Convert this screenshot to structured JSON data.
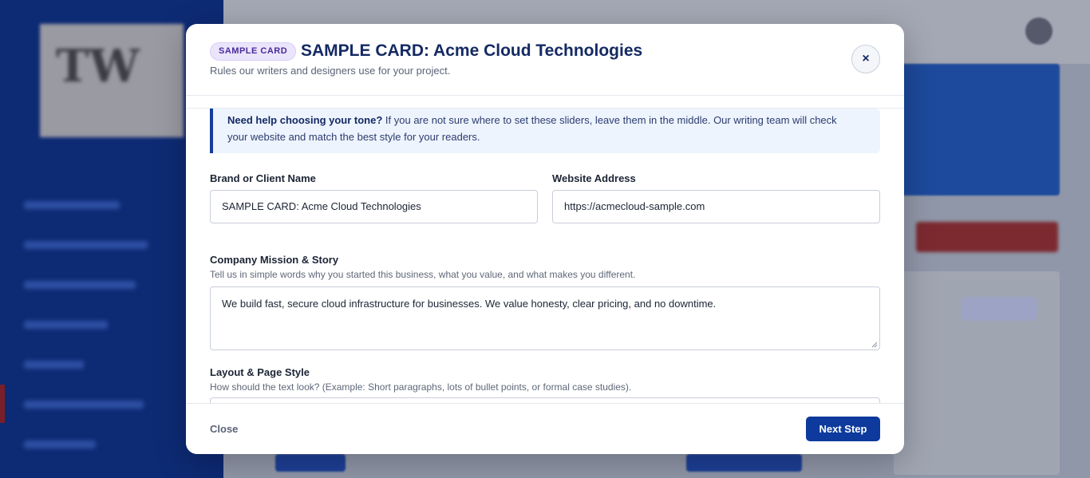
{
  "modal": {
    "badge": "SAMPLE CARD",
    "title": "SAMPLE CARD: Acme Cloud Technologies",
    "subtitle": "Rules our writers and designers use for your project.",
    "close_icon": "×"
  },
  "help": {
    "heading": "Need help choosing your tone?",
    "body": " If you are not sure where to set these sliders, leave them in the middle. Our writing team will check your website and match the best style for your readers."
  },
  "form": {
    "brand_label": "Brand or Client Name",
    "brand_value": "SAMPLE CARD: Acme Cloud Technologies",
    "website_label": "Website Address",
    "website_value": "https://acmecloud-sample.com",
    "mission_label": "Company Mission & Story",
    "mission_hint": "Tell us in simple words why you started this business, what you value, and what makes you different.",
    "mission_value": "We build fast, secure cloud infrastructure for businesses. We value honesty, clear pricing, and no downtime.",
    "layout_label": "Layout & Page Style",
    "layout_hint": "How should the text look? (Example: Short paragraphs, lots of bullet points, or formal case studies)."
  },
  "footer": {
    "close_label": "Close",
    "next_label": "Next Step"
  },
  "colors": {
    "accent": "#0d3a9c",
    "title": "#142a63",
    "badge_bg": "#ebe5fb",
    "help_bg": "#eef4fe"
  },
  "icons": {
    "close": "close-icon",
    "resize": "resize-grip-icon"
  }
}
